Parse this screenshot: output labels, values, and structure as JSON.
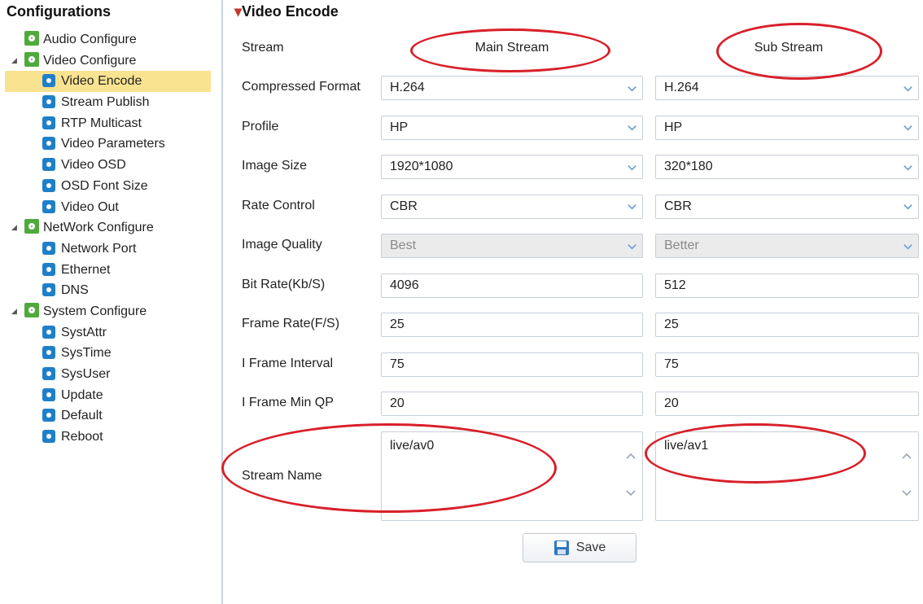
{
  "sidebar": {
    "title": "Configurations",
    "items": [
      {
        "label": "Audio Configure",
        "level": 0,
        "icon": "gear-group-icon",
        "expandable": false
      },
      {
        "label": "Video Configure",
        "level": 0,
        "icon": "gear-group-icon",
        "expandable": true
      },
      {
        "label": "Video Encode",
        "level": 1,
        "icon": "settings-icon",
        "selected": true
      },
      {
        "label": "Stream Publish",
        "level": 1,
        "icon": "settings-icon"
      },
      {
        "label": "RTP Multicast",
        "level": 1,
        "icon": "settings-icon"
      },
      {
        "label": "Video Parameters",
        "level": 1,
        "icon": "settings-icon"
      },
      {
        "label": "Video OSD",
        "level": 1,
        "icon": "settings-icon"
      },
      {
        "label": "OSD Font Size",
        "level": 1,
        "icon": "settings-icon"
      },
      {
        "label": "Video Out",
        "level": 1,
        "icon": "settings-icon"
      },
      {
        "label": "NetWork Configure",
        "level": 0,
        "icon": "gear-group-icon",
        "expandable": true
      },
      {
        "label": "Network Port",
        "level": 1,
        "icon": "settings-icon"
      },
      {
        "label": "Ethernet",
        "level": 1,
        "icon": "settings-icon"
      },
      {
        "label": "DNS",
        "level": 1,
        "icon": "settings-icon"
      },
      {
        "label": "System Configure",
        "level": 0,
        "icon": "gear-group-icon",
        "expandable": true
      },
      {
        "label": "SystAttr",
        "level": 1,
        "icon": "settings-icon"
      },
      {
        "label": "SysTime",
        "level": 1,
        "icon": "settings-icon"
      },
      {
        "label": "SysUser",
        "level": 1,
        "icon": "settings-icon"
      },
      {
        "label": "Update",
        "level": 1,
        "icon": "settings-icon"
      },
      {
        "label": "Default",
        "level": 1,
        "icon": "settings-icon"
      },
      {
        "label": "Reboot",
        "level": 1,
        "icon": "settings-icon"
      }
    ]
  },
  "main": {
    "title": "Video Encode",
    "stream_label": "Stream",
    "main_stream": "Main Stream",
    "sub_stream": "Sub Stream",
    "rows": [
      {
        "label": "Compressed Format",
        "type": "select",
        "main": "H.264",
        "sub": "H.264"
      },
      {
        "label": "Profile",
        "type": "select",
        "main": "HP",
        "sub": "HP"
      },
      {
        "label": "Image Size",
        "type": "select",
        "main": "1920*1080",
        "sub": "320*180"
      },
      {
        "label": "Rate Control",
        "type": "select",
        "main": "CBR",
        "sub": "CBR"
      },
      {
        "label": "Image Quality",
        "type": "select-disabled",
        "main": "Best",
        "sub": "Better"
      },
      {
        "label": "Bit Rate(Kb/S)",
        "type": "input",
        "main": "4096",
        "sub": "512"
      },
      {
        "label": "Frame Rate(F/S)",
        "type": "input",
        "main": "25",
        "sub": "25"
      },
      {
        "label": "I Frame Interval",
        "type": "input",
        "main": "75",
        "sub": "75"
      },
      {
        "label": "I Frame Min QP",
        "type": "input",
        "main": "20",
        "sub": "20"
      }
    ],
    "stream_name": {
      "label": "Stream Name",
      "main": "live/av0",
      "sub": "live/av1"
    },
    "save_label": "Save"
  },
  "colors": {
    "highlight": "#d8202a",
    "selected_bg": "#f9e391",
    "icon_green": "#4faa3c",
    "icon_blue": "#1f7fc8"
  }
}
